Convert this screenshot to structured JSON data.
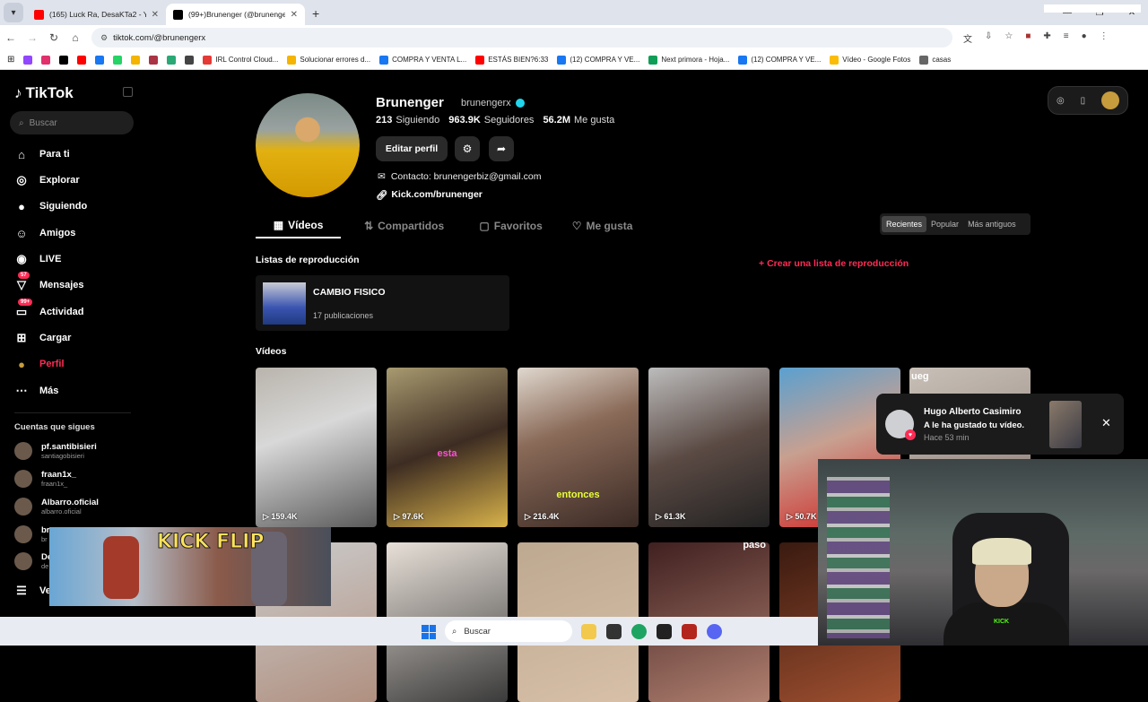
{
  "browser": {
    "tabs": [
      {
        "title": "(165) Luck Ra, DesaKTa2 - YA SÉ",
        "color": "#ff0000"
      },
      {
        "title": "(99+)Brunenger (@brunengerx)",
        "color": "#000000",
        "active": true
      }
    ],
    "url": "tiktok.com/@brunengerx",
    "bookmarks": [
      {
        "label": "",
        "color": "#9146ff"
      },
      {
        "label": "",
        "color": "#e1306c"
      },
      {
        "label": "",
        "color": "#000000"
      },
      {
        "label": "",
        "color": "#ff0000"
      },
      {
        "label": "",
        "color": "#1877f2"
      },
      {
        "label": "",
        "color": "#25d366"
      },
      {
        "label": "",
        "color": "#f4b400"
      },
      {
        "label": "",
        "color": "#aa3344"
      },
      {
        "label": "",
        "color": "#2aa876"
      },
      {
        "label": "",
        "color": "#444444"
      },
      {
        "label": "IRL Control Cloud...",
        "color": "#e53935"
      },
      {
        "label": "Solucionar errores d...",
        "color": "#f4b400"
      },
      {
        "label": "COMPRA Y VENTA L...",
        "color": "#1877f2"
      },
      {
        "label": "ESTÁS BIEN?6:33",
        "color": "#ff0000"
      },
      {
        "label": "(12) COMPRA Y VE...",
        "color": "#1877f2"
      },
      {
        "label": "Next primora - Hoja...",
        "color": "#0f9d58"
      },
      {
        "label": "(12) COMPRA Y VE...",
        "color": "#1877f2"
      },
      {
        "label": "Vídeo - Google Fotos",
        "color": "#fbbc05"
      },
      {
        "label": "casas",
        "color": "#666666"
      }
    ],
    "all_bookmarks": "Todos los marcadores"
  },
  "sidebar": {
    "logo": "TikTok",
    "search_placeholder": "Buscar",
    "items": [
      {
        "label": "Para ti",
        "icon": "home-icon"
      },
      {
        "label": "Explorar",
        "icon": "compass-icon"
      },
      {
        "label": "Siguiendo",
        "icon": "following-icon"
      },
      {
        "label": "Amigos",
        "icon": "friends-icon"
      },
      {
        "label": "LIVE",
        "icon": "live-icon"
      },
      {
        "label": "Mensajes",
        "icon": "messages-icon",
        "badge": "57"
      },
      {
        "label": "Actividad",
        "icon": "activity-icon",
        "badge": "99+"
      },
      {
        "label": "Cargar",
        "icon": "upload-icon"
      },
      {
        "label": "Perfil",
        "icon": "profile-icon",
        "active": true
      },
      {
        "label": "Más",
        "icon": "more-icon"
      }
    ],
    "following_title": "Cuentas que sigues",
    "accounts": [
      {
        "name": "pf.santibisieri",
        "handle": "santiagobisieri"
      },
      {
        "name": "fraan1x_",
        "handle": "fraan1x_"
      },
      {
        "name": "Albarro.oficial",
        "handle": "albarro.oficial"
      },
      {
        "name": "br",
        "handle": "br"
      },
      {
        "name": "De",
        "handle": "de"
      }
    ],
    "see_more": "Ve"
  },
  "profile": {
    "name": "Brunenger",
    "handle": "brunengerx",
    "following_count": "213",
    "following_label": "Siguiendo",
    "followers_count": "963.9K",
    "followers_label": "Seguidores",
    "likes_count": "56.2M",
    "likes_label": "Me gusta",
    "edit_label": "Editar perfil",
    "contact": "Contacto: brunengerbiz@gmail.com",
    "link": "Kick.com/brunenger"
  },
  "tabs": [
    {
      "label": "Vídeos",
      "active": true
    },
    {
      "label": "Compartidos"
    },
    {
      "label": "Favoritos"
    },
    {
      "label": "Me gusta"
    }
  ],
  "sort": [
    "Recientes",
    "Popular",
    "Más antiguos"
  ],
  "playlists": {
    "heading": "Listas de reproducción",
    "create": "Crear una lista de reproducción",
    "items": [
      {
        "title": "CAMBIO FISICO",
        "count": "17 publicaciones"
      }
    ]
  },
  "videos": {
    "heading": "Vídeos",
    "items": [
      {
        "views": "159.4K",
        "caption": ""
      },
      {
        "views": "97.6K",
        "caption": "esta"
      },
      {
        "views": "216.4K",
        "caption": "entonces"
      },
      {
        "views": "61.3K",
        "caption": ""
      },
      {
        "views": "50.7K",
        "caption": ""
      },
      {
        "views": "",
        "caption": "ueg"
      },
      {
        "views": "",
        "caption": ""
      },
      {
        "views": "",
        "caption": ""
      },
      {
        "views": "",
        "caption": ""
      },
      {
        "views": "",
        "caption": "paso"
      },
      {
        "views": "",
        "caption": ""
      }
    ]
  },
  "notification": {
    "user": "Hugo Alberto Casimiro",
    "text": "A le ha gustado tu vídeo.",
    "time": "Hace 53 min"
  },
  "overlay": {
    "game_text": "KICK FLIP",
    "cam_text": "KICK"
  },
  "taskbar": {
    "search": "Buscar"
  }
}
